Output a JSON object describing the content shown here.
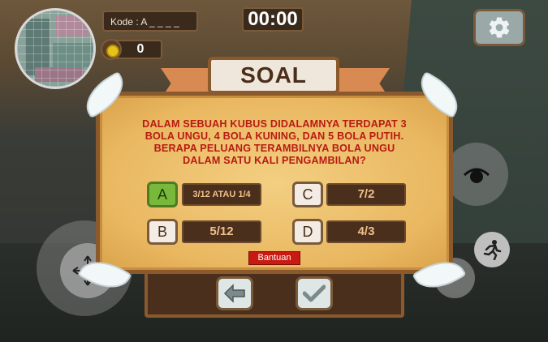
{
  "hud": {
    "code_label": "Kode : A _ _ _ _",
    "timer": "00:00",
    "coins": "0"
  },
  "quiz": {
    "title": "SOAL",
    "question_lines": [
      "DALAM SEBUAH KUBUS DIDALAMNYA TERDAPAT 3",
      "BOLA UNGU, 4 BOLA KUNING, DAN 5 BOLA PUTIH.",
      "BERAPA PELUANG TERAMBILNYA BOLA UNGU",
      "DALAM SATU KALI PENGAMBILAN?"
    ],
    "options": [
      {
        "letter": "A",
        "value": "3/12 ATAU 1/4",
        "selected": true
      },
      {
        "letter": "B",
        "value": "5/12",
        "selected": false
      },
      {
        "letter": "C",
        "value": "7/2",
        "selected": false
      },
      {
        "letter": "D",
        "value": "4/3",
        "selected": false
      }
    ],
    "help_label": "Bantuan"
  },
  "icons": {
    "settings": "gear-icon",
    "back": "arrow-left-icon",
    "confirm": "checkmark-icon",
    "look": "eye-icon",
    "run": "running-person-icon",
    "move": "move-arrows-icon",
    "coin": "coin-icon"
  },
  "colors": {
    "panel": "#e9b760",
    "question_text": "#b81a12",
    "selected_option": "#78b83a",
    "help_button": "#c81a12",
    "option_value_bg": "#4a2f1c"
  }
}
